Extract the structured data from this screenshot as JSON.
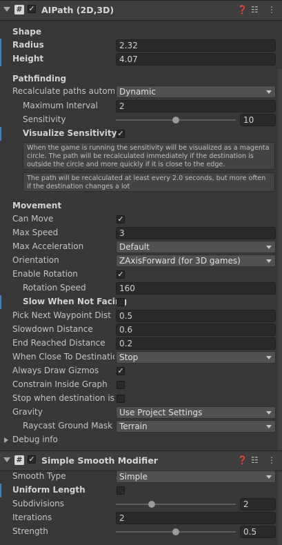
{
  "aipath": {
    "title": "AIPath (2D,3D)",
    "script_glyph": "#",
    "shape_section": "Shape",
    "radius_label": "Radius",
    "radius_value": "2.32",
    "height_label": "Height",
    "height_value": "4.07",
    "pathfinding_section": "Pathfinding",
    "recalc_label": "Recalculate paths automat",
    "recalc_value": "Dynamic",
    "max_interval_label": "Maximum Interval",
    "max_interval_value": "2",
    "sensitivity_label": "Sensitivity",
    "sensitivity_value": "10",
    "sensitivity_slider_fraction": 0.5,
    "visualize_label": "Visualize Sensitivity",
    "help1": "When the game is running the sensitivity will be visualized as a magenta circle. The path will be recalculated immediately if the destination is outside the circle and more quickly if it is close to the edge.",
    "help2": "The path will be recalculated at least every 2.0 seconds, but more often if the destination changes a lot",
    "movement_section": "Movement",
    "can_move_label": "Can Move",
    "max_speed_label": "Max Speed",
    "max_speed_value": "3",
    "max_accel_label": "Max Acceleration",
    "max_accel_value": "Default",
    "orientation_label": "Orientation",
    "orientation_value": "ZAxisForward (for 3D games)",
    "enable_rotation_label": "Enable Rotation",
    "rotation_speed_label": "Rotation Speed",
    "rotation_speed_value": "160",
    "slow_when_label": "Slow When Not Facing",
    "pick_next_label": "Pick Next Waypoint Dist",
    "pick_next_value": "0.5",
    "slowdown_label": "Slowdown Distance",
    "slowdown_value": "0.6",
    "end_reached_label": "End Reached Distance",
    "end_reached_value": "0.2",
    "when_close_label": "When Close To Destinatio",
    "when_close_value": "Stop",
    "always_draw_label": "Always Draw Gizmos",
    "constrain_label": "Constrain Inside Graph",
    "stop_when_label": "Stop when destination is c",
    "gravity_label": "Gravity",
    "gravity_value": "Use Project Settings",
    "raycast_label": "Raycast Ground Mask",
    "raycast_value": "Terrain",
    "debug_label": "Debug info"
  },
  "smooth": {
    "title": "Simple Smooth Modifier",
    "script_glyph": "#",
    "smooth_type_label": "Smooth Type",
    "smooth_type_value": "Simple",
    "uniform_label": "Uniform Length",
    "subdivisions_label": "Subdivisions",
    "subdivisions_value": "2",
    "subdivisions_fraction": 0.3,
    "iterations_label": "Iterations",
    "iterations_value": "2",
    "strength_label": "Strength",
    "strength_value": "0.5",
    "strength_fraction": 0.5
  },
  "checkmark": "✓",
  "checks": {
    "aipath_enabled": true,
    "visualize_sensitivity": true,
    "can_move": true,
    "enable_rotation": true,
    "slow_when_not_facing": false,
    "always_draw_gizmos": true,
    "constrain_inside_graph": false,
    "stop_when_destination": false,
    "smooth_enabled": true,
    "uniform_length": false
  },
  "header_icons": [
    "help-icon",
    "presets-icon",
    "more-options-icon"
  ],
  "colors": {
    "background": "#383838",
    "field": "#2a2a2a",
    "dropdown": "#515151",
    "modified_marker": "#3c82c8"
  }
}
